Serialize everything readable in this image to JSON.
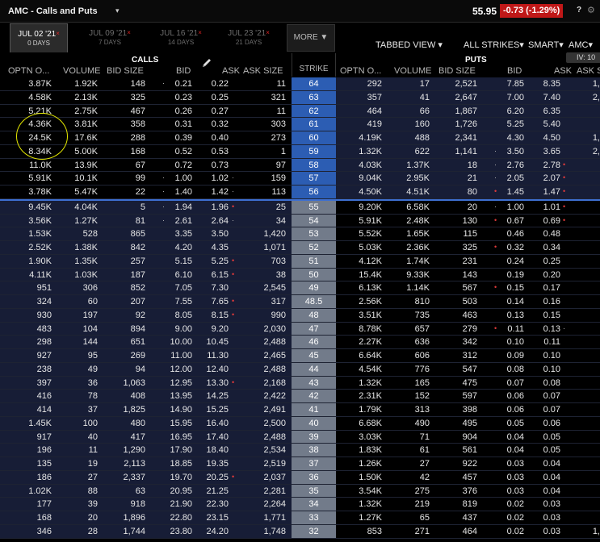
{
  "window": {
    "title": "AMC - Calls and Puts",
    "last_price": "55.95",
    "change": "-0.73 (-1.29%)",
    "help": "?",
    "gear_icon": "gear-icon"
  },
  "expiries": [
    {
      "date": "JUL 02 '21",
      "days": "0 DAYS",
      "active": true
    },
    {
      "date": "JUL 09 '21",
      "days": "7 DAYS",
      "active": false
    },
    {
      "date": "JUL 16 '21",
      "days": "14 DAYS",
      "active": false
    },
    {
      "date": "JUL 23 '21",
      "days": "21 DAYS",
      "active": false
    }
  ],
  "more_label": "MORE ▼",
  "toolbar": {
    "view": "TABBED VIEW ▾",
    "strikes": "ALL STRIKES▾",
    "route": "SMART▾",
    "underlying": "AMC▾",
    "iv": "IV: 10"
  },
  "headers": {
    "calls": "CALLS",
    "puts": "PUTS",
    "strike": "STRIKE",
    "call_cols": [
      "OPTN O...",
      "VOLUME",
      "BID SIZE",
      "BID",
      "ASK",
      "ASK SIZE"
    ],
    "put_cols": [
      "OPTN O...",
      "VOLUME",
      "BID SIZE",
      "BID",
      "ASK",
      "ASK SIZE"
    ]
  },
  "colors": {
    "itm_strike": "#2c5db3",
    "otm_strike": "#727b8a",
    "itm_row": "#171d36",
    "change_bg": "#c01818",
    "annotation": "#e4e800"
  },
  "rows": [
    {
      "strike": "64",
      "c_oi": "3.87K",
      "c_vol": "1.92K",
      "c_bsz": "148",
      "c_bid": "0.21",
      "c_ask": "0.22",
      "c_asz": "11",
      "p_oi": "292",
      "p_vol": "17",
      "p_bsz": "2,521",
      "p_bid": "7.85",
      "p_ask": "8.35",
      "p_asz": "1,",
      "cb_dot": "·",
      "ca_dot": "",
      "pb_dot": "",
      "pa_dot": ""
    },
    {
      "strike": "63",
      "c_oi": "4.58K",
      "c_vol": "2.13K",
      "c_bsz": "325",
      "c_bid": "0.23",
      "c_ask": "0.25",
      "c_asz": "321",
      "p_oi": "357",
      "p_vol": "41",
      "p_bsz": "2,647",
      "p_bid": "7.00",
      "p_ask": "7.40",
      "p_asz": "2,",
      "cb_dot": "",
      "ca_dot": "",
      "pb_dot": "",
      "pa_dot": ""
    },
    {
      "strike": "62",
      "c_oi": "5.21K",
      "c_vol": "2.75K",
      "c_bsz": "467",
      "c_bid": "0.26",
      "c_ask": "0.27",
      "c_asz": "11",
      "p_oi": "464",
      "p_vol": "66",
      "p_bsz": "1,867",
      "p_bid": "6.20",
      "p_ask": "6.35",
      "p_asz": "",
      "cb_dot": "",
      "ca_dot": "",
      "pb_dot": "",
      "pa_dot": ""
    },
    {
      "strike": "61",
      "c_oi": "4.36K",
      "c_vol": "3.81K",
      "c_bsz": "358",
      "c_bid": "0.31",
      "c_ask": "0.32",
      "c_asz": "303",
      "p_oi": "419",
      "p_vol": "160",
      "p_bsz": "1,726",
      "p_bid": "5.25",
      "p_ask": "5.40",
      "p_asz": "",
      "cb_dot": "",
      "ca_dot": "",
      "pb_dot": "",
      "pa_dot": ""
    },
    {
      "strike": "60",
      "c_oi": "24.5K",
      "c_vol": "17.6K",
      "c_bsz": "288",
      "c_bid": "0.39",
      "c_ask": "0.40",
      "c_asz": "273",
      "p_oi": "4.19K",
      "p_vol": "488",
      "p_bsz": "2,341",
      "p_bid": "4.30",
      "p_ask": "4.50",
      "p_asz": "1,",
      "cb_dot": "",
      "ca_dot": "",
      "pb_dot": "",
      "pa_dot": ""
    },
    {
      "strike": "59",
      "c_oi": "8.34K",
      "c_vol": "5.00K",
      "c_bsz": "168",
      "c_bid": "0.52",
      "c_ask": "0.53",
      "c_asz": "1",
      "p_oi": "1.32K",
      "p_vol": "622",
      "p_bsz": "1,141",
      "p_bid": "3.50",
      "p_ask": "3.65",
      "p_asz": "2,",
      "cb_dot": "",
      "ca_dot": "",
      "pb_dot": "·",
      "pa_dot": ""
    },
    {
      "strike": "58",
      "c_oi": "11.0K",
      "c_vol": "13.9K",
      "c_bsz": "67",
      "c_bid": "0.72",
      "c_ask": "0.73",
      "c_asz": "97",
      "p_oi": "4.03K",
      "p_vol": "1.37K",
      "p_bsz": "18",
      "p_bid": "2.76",
      "p_ask": "2.78",
      "p_asz": "",
      "cb_dot": "",
      "ca_dot": "",
      "pb_dot": "·",
      "pa_dot": "•"
    },
    {
      "strike": "57",
      "c_oi": "5.91K",
      "c_vol": "10.1K",
      "c_bsz": "99",
      "c_bid": "1.00",
      "c_ask": "1.02",
      "c_asz": "159",
      "p_oi": "9.04K",
      "p_vol": "2.95K",
      "p_bsz": "21",
      "p_bid": "2.05",
      "p_ask": "2.07",
      "p_asz": "",
      "cb_dot": "·",
      "ca_dot": "·",
      "pb_dot": "·",
      "pa_dot": "•"
    },
    {
      "strike": "56",
      "c_oi": "3.78K",
      "c_vol": "5.47K",
      "c_bsz": "22",
      "c_bid": "1.40",
      "c_ask": "1.42",
      "c_asz": "113",
      "p_oi": "4.50K",
      "p_vol": "4.51K",
      "p_bsz": "80",
      "p_bid": "1.45",
      "p_ask": "1.47",
      "p_asz": "",
      "cb_dot": "·",
      "ca_dot": "·",
      "pb_dot": "•",
      "pa_dot": "•"
    },
    {
      "strike": "55",
      "c_oi": "9.45K",
      "c_vol": "4.04K",
      "c_bsz": "5",
      "c_bid": "1.94",
      "c_ask": "1.96",
      "c_asz": "25",
      "p_oi": "9.20K",
      "p_vol": "6.58K",
      "p_bsz": "20",
      "p_bid": "1.00",
      "p_ask": "1.01",
      "p_asz": "",
      "cb_dot": "·",
      "ca_dot": "•",
      "pb_dot": "·",
      "pa_dot": "•"
    },
    {
      "strike": "54",
      "c_oi": "3.56K",
      "c_vol": "1.27K",
      "c_bsz": "81",
      "c_bid": "2.61",
      "c_ask": "2.64",
      "c_asz": "34",
      "p_oi": "5.91K",
      "p_vol": "2.48K",
      "p_bsz": "130",
      "p_bid": "0.67",
      "p_ask": "0.69",
      "p_asz": "",
      "cb_dot": "·",
      "ca_dot": "·",
      "pb_dot": "•",
      "pa_dot": "•"
    },
    {
      "strike": "53",
      "c_oi": "1.53K",
      "c_vol": "528",
      "c_bsz": "865",
      "c_bid": "3.35",
      "c_ask": "3.50",
      "c_asz": "1,420",
      "p_oi": "5.52K",
      "p_vol": "1.65K",
      "p_bsz": "115",
      "p_bid": "0.46",
      "p_ask": "0.48",
      "p_asz": "",
      "cb_dot": "",
      "ca_dot": "",
      "pb_dot": "",
      "pa_dot": ""
    },
    {
      "strike": "52",
      "c_oi": "2.52K",
      "c_vol": "1.38K",
      "c_bsz": "842",
      "c_bid": "4.20",
      "c_ask": "4.35",
      "c_asz": "1,071",
      "p_oi": "5.03K",
      "p_vol": "2.36K",
      "p_bsz": "325",
      "p_bid": "0.32",
      "p_ask": "0.34",
      "p_asz": "",
      "cb_dot": "",
      "ca_dot": "",
      "pb_dot": "•",
      "pa_dot": ""
    },
    {
      "strike": "51",
      "c_oi": "1.90K",
      "c_vol": "1.35K",
      "c_bsz": "257",
      "c_bid": "5.15",
      "c_ask": "5.25",
      "c_asz": "703",
      "p_oi": "4.12K",
      "p_vol": "1.74K",
      "p_bsz": "231",
      "p_bid": "0.24",
      "p_ask": "0.25",
      "p_asz": "",
      "cb_dot": "",
      "ca_dot": "•",
      "pb_dot": "",
      "pa_dot": ""
    },
    {
      "strike": "50",
      "c_oi": "4.11K",
      "c_vol": "1.03K",
      "c_bsz": "187",
      "c_bid": "6.10",
      "c_ask": "6.15",
      "c_asz": "38",
      "p_oi": "15.4K",
      "p_vol": "9.33K",
      "p_bsz": "143",
      "p_bid": "0.19",
      "p_ask": "0.20",
      "p_asz": "",
      "cb_dot": "",
      "ca_dot": "•",
      "pb_dot": "",
      "pa_dot": ""
    },
    {
      "strike": "49",
      "c_oi": "951",
      "c_vol": "306",
      "c_bsz": "852",
      "c_bid": "7.05",
      "c_ask": "7.30",
      "c_asz": "2,545",
      "p_oi": "6.13K",
      "p_vol": "1.14K",
      "p_bsz": "567",
      "p_bid": "0.15",
      "p_ask": "0.17",
      "p_asz": "",
      "cb_dot": "",
      "ca_dot": "",
      "pb_dot": "•",
      "pa_dot": ""
    },
    {
      "strike": "48.5",
      "c_oi": "324",
      "c_vol": "60",
      "c_bsz": "207",
      "c_bid": "7.55",
      "c_ask": "7.65",
      "c_asz": "317",
      "p_oi": "2.56K",
      "p_vol": "810",
      "p_bsz": "503",
      "p_bid": "0.14",
      "p_ask": "0.16",
      "p_asz": "",
      "cb_dot": "",
      "ca_dot": "•",
      "pb_dot": "",
      "pa_dot": ""
    },
    {
      "strike": "48",
      "c_oi": "930",
      "c_vol": "197",
      "c_bsz": "92",
      "c_bid": "8.05",
      "c_ask": "8.15",
      "c_asz": "990",
      "p_oi": "3.51K",
      "p_vol": "735",
      "p_bsz": "463",
      "p_bid": "0.13",
      "p_ask": "0.15",
      "p_asz": "",
      "cb_dot": "",
      "ca_dot": "•",
      "pb_dot": "",
      "pa_dot": ""
    },
    {
      "strike": "47",
      "c_oi": "483",
      "c_vol": "104",
      "c_bsz": "894",
      "c_bid": "9.00",
      "c_ask": "9.20",
      "c_asz": "2,030",
      "p_oi": "8.78K",
      "p_vol": "657",
      "p_bsz": "279",
      "p_bid": "0.11",
      "p_ask": "0.13",
      "p_asz": "",
      "cb_dot": "",
      "ca_dot": "",
      "pb_dot": "•",
      "pa_dot": "·"
    },
    {
      "strike": "46",
      "c_oi": "298",
      "c_vol": "144",
      "c_bsz": "651",
      "c_bid": "10.00",
      "c_ask": "10.45",
      "c_asz": "2,488",
      "p_oi": "2.27K",
      "p_vol": "636",
      "p_bsz": "342",
      "p_bid": "0.10",
      "p_ask": "0.11",
      "p_asz": "",
      "cb_dot": "",
      "ca_dot": "",
      "pb_dot": "",
      "pa_dot": ""
    },
    {
      "strike": "45",
      "c_oi": "927",
      "c_vol": "95",
      "c_bsz": "269",
      "c_bid": "11.00",
      "c_ask": "11.30",
      "c_asz": "2,465",
      "p_oi": "6.64K",
      "p_vol": "606",
      "p_bsz": "312",
      "p_bid": "0.09",
      "p_ask": "0.10",
      "p_asz": "",
      "cb_dot": "",
      "ca_dot": "",
      "pb_dot": "",
      "pa_dot": ""
    },
    {
      "strike": "44",
      "c_oi": "238",
      "c_vol": "49",
      "c_bsz": "94",
      "c_bid": "12.00",
      "c_ask": "12.40",
      "c_asz": "2,488",
      "p_oi": "4.54K",
      "p_vol": "776",
      "p_bsz": "547",
      "p_bid": "0.08",
      "p_ask": "0.10",
      "p_asz": "",
      "cb_dot": "",
      "ca_dot": "",
      "pb_dot": "",
      "pa_dot": ""
    },
    {
      "strike": "43",
      "c_oi": "397",
      "c_vol": "36",
      "c_bsz": "1,063",
      "c_bid": "12.95",
      "c_ask": "13.30",
      "c_asz": "2,168",
      "p_oi": "1.32K",
      "p_vol": "165",
      "p_bsz": "475",
      "p_bid": "0.07",
      "p_ask": "0.08",
      "p_asz": "",
      "cb_dot": "",
      "ca_dot": "•",
      "pb_dot": "",
      "pa_dot": ""
    },
    {
      "strike": "42",
      "c_oi": "416",
      "c_vol": "78",
      "c_bsz": "408",
      "c_bid": "13.95",
      "c_ask": "14.25",
      "c_asz": "2,422",
      "p_oi": "2.31K",
      "p_vol": "152",
      "p_bsz": "597",
      "p_bid": "0.06",
      "p_ask": "0.07",
      "p_asz": "",
      "cb_dot": "",
      "ca_dot": "",
      "pb_dot": "",
      "pa_dot": ""
    },
    {
      "strike": "41",
      "c_oi": "414",
      "c_vol": "37",
      "c_bsz": "1,825",
      "c_bid": "14.90",
      "c_ask": "15.25",
      "c_asz": "2,491",
      "p_oi": "1.79K",
      "p_vol": "313",
      "p_bsz": "398",
      "p_bid": "0.06",
      "p_ask": "0.07",
      "p_asz": "",
      "cb_dot": "",
      "ca_dot": "",
      "pb_dot": "",
      "pa_dot": ""
    },
    {
      "strike": "40",
      "c_oi": "1.45K",
      "c_vol": "100",
      "c_bsz": "480",
      "c_bid": "15.95",
      "c_ask": "16.40",
      "c_asz": "2,500",
      "p_oi": "6.68K",
      "p_vol": "490",
      "p_bsz": "495",
      "p_bid": "0.05",
      "p_ask": "0.06",
      "p_asz": "",
      "cb_dot": "",
      "ca_dot": "",
      "pb_dot": "",
      "pa_dot": ""
    },
    {
      "strike": "39",
      "c_oi": "917",
      "c_vol": "40",
      "c_bsz": "417",
      "c_bid": "16.95",
      "c_ask": "17.40",
      "c_asz": "2,488",
      "p_oi": "3.03K",
      "p_vol": "71",
      "p_bsz": "904",
      "p_bid": "0.04",
      "p_ask": "0.05",
      "p_asz": "",
      "cb_dot": "",
      "ca_dot": "",
      "pb_dot": "",
      "pa_dot": ""
    },
    {
      "strike": "38",
      "c_oi": "196",
      "c_vol": "11",
      "c_bsz": "1,290",
      "c_bid": "17.90",
      "c_ask": "18.40",
      "c_asz": "2,534",
      "p_oi": "1.83K",
      "p_vol": "61",
      "p_bsz": "561",
      "p_bid": "0.04",
      "p_ask": "0.05",
      "p_asz": "",
      "cb_dot": "",
      "ca_dot": "",
      "pb_dot": "",
      "pa_dot": ""
    },
    {
      "strike": "37",
      "c_oi": "135",
      "c_vol": "19",
      "c_bsz": "2,113",
      "c_bid": "18.85",
      "c_ask": "19.35",
      "c_asz": "2,519",
      "p_oi": "1.26K",
      "p_vol": "27",
      "p_bsz": "922",
      "p_bid": "0.03",
      "p_ask": "0.04",
      "p_asz": "",
      "cb_dot": "",
      "ca_dot": "",
      "pb_dot": "",
      "pa_dot": ""
    },
    {
      "strike": "36",
      "c_oi": "186",
      "c_vol": "27",
      "c_bsz": "2,337",
      "c_bid": "19.70",
      "c_ask": "20.25",
      "c_asz": "2,037",
      "p_oi": "1.50K",
      "p_vol": "42",
      "p_bsz": "457",
      "p_bid": "0.03",
      "p_ask": "0.04",
      "p_asz": "",
      "cb_dot": "",
      "ca_dot": "•",
      "pb_dot": "",
      "pa_dot": ""
    },
    {
      "strike": "35",
      "c_oi": "1.02K",
      "c_vol": "88",
      "c_bsz": "63",
      "c_bid": "20.95",
      "c_ask": "21.25",
      "c_asz": "2,281",
      "p_oi": "3.54K",
      "p_vol": "275",
      "p_bsz": "376",
      "p_bid": "0.03",
      "p_ask": "0.04",
      "p_asz": "",
      "cb_dot": "",
      "ca_dot": "",
      "pb_dot": "",
      "pa_dot": ""
    },
    {
      "strike": "34",
      "c_oi": "177",
      "c_vol": "39",
      "c_bsz": "918",
      "c_bid": "21.90",
      "c_ask": "22.30",
      "c_asz": "2,264",
      "p_oi": "1.32K",
      "p_vol": "219",
      "p_bsz": "819",
      "p_bid": "0.02",
      "p_ask": "0.03",
      "p_asz": "",
      "cb_dot": "",
      "ca_dot": "",
      "pb_dot": "",
      "pa_dot": ""
    },
    {
      "strike": "33",
      "c_oi": "168",
      "c_vol": "20",
      "c_bsz": "1,896",
      "c_bid": "22.80",
      "c_ask": "23.15",
      "c_asz": "1,771",
      "p_oi": "1.27K",
      "p_vol": "65",
      "p_bsz": "437",
      "p_bid": "0.02",
      "p_ask": "0.03",
      "p_asz": "",
      "cb_dot": "",
      "ca_dot": "",
      "pb_dot": "",
      "pa_dot": ""
    },
    {
      "strike": "32",
      "c_oi": "346",
      "c_vol": "28",
      "c_bsz": "1,744",
      "c_bid": "23.80",
      "c_ask": "24.20",
      "c_asz": "1,748",
      "p_oi": "853",
      "p_vol": "271",
      "p_bsz": "464",
      "p_bid": "0.02",
      "p_ask": "0.03",
      "p_asz": "1,",
      "cb_dot": "",
      "ca_dot": "",
      "pb_dot": "",
      "pa_dot": ""
    }
  ]
}
